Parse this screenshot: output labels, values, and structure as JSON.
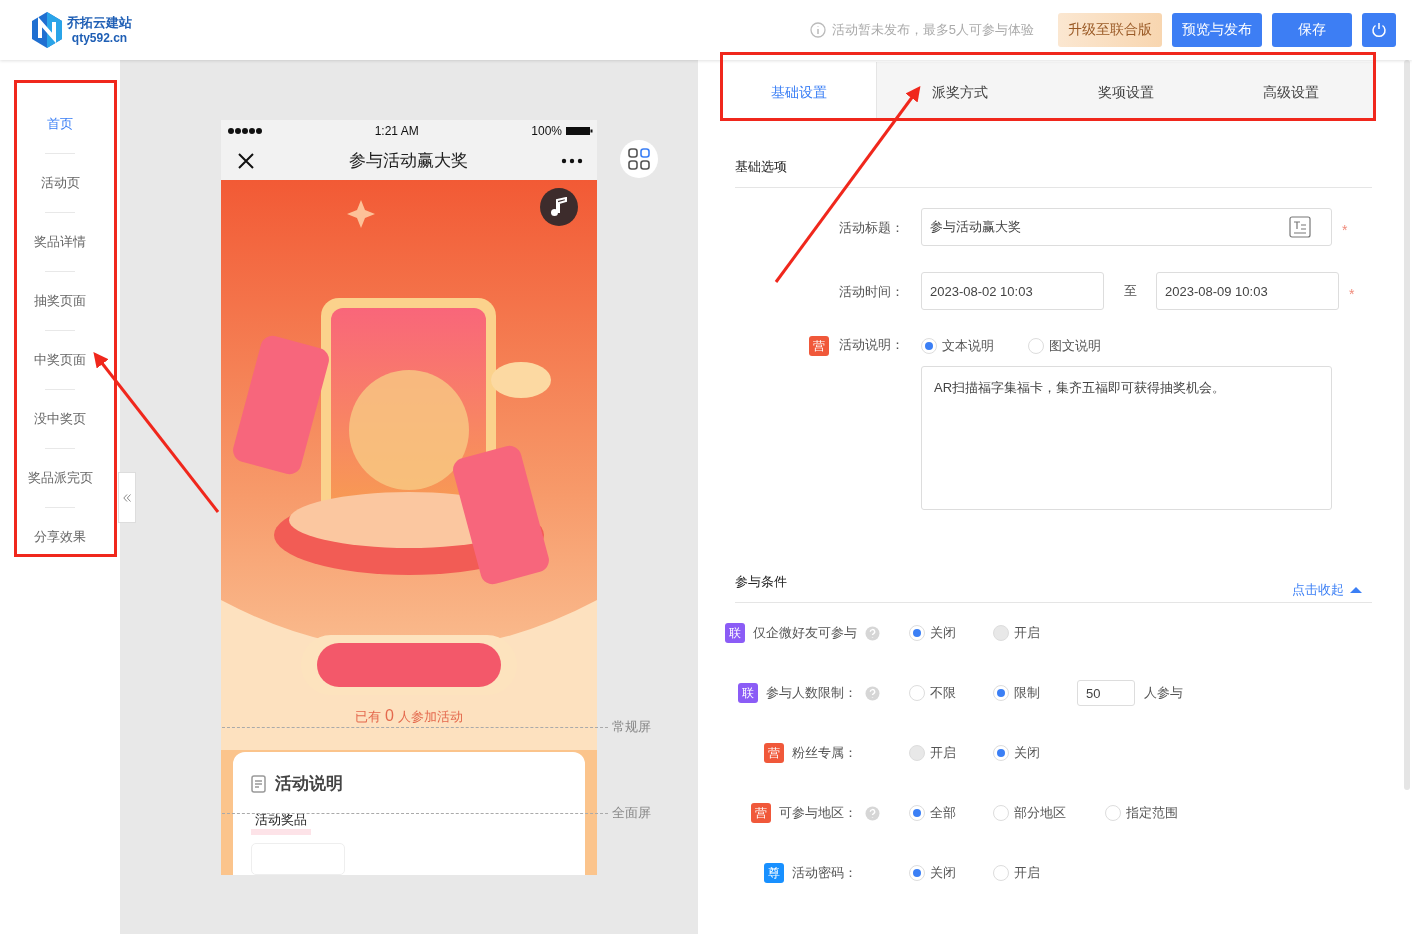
{
  "header": {
    "logo_name": "乔拓云建站",
    "logo_domain": "qty592.cn",
    "notice": "活动暂未发布，最多5人可参与体验",
    "buttons": [
      {
        "label": "升级至联合版",
        "kind": "upgrade"
      },
      {
        "label": "预览与发布",
        "kind": "primary"
      },
      {
        "label": "保存",
        "kind": "primary"
      }
    ]
  },
  "sidebar": {
    "items": [
      {
        "label": "首页",
        "selected": true
      },
      {
        "label": "活动页",
        "selected": false
      },
      {
        "label": "奖品详情",
        "selected": false
      },
      {
        "label": "抽奖页面",
        "selected": false
      },
      {
        "label": "中奖页面",
        "selected": false
      },
      {
        "label": "没中奖页",
        "selected": false
      },
      {
        "label": "奖品派完页",
        "selected": false
      },
      {
        "label": "分享效果",
        "selected": false
      }
    ]
  },
  "preview": {
    "status_bar": {
      "time": "1:21 AM",
      "battery": "100%"
    },
    "page_title": "参与活动赢大奖",
    "participants": {
      "prefix": "已有",
      "count": "0",
      "suffix": "人参加活动"
    },
    "card": {
      "title": "活动说明",
      "tab": "活动奖品"
    },
    "screen_marks": [
      "常规屏",
      "全面屏"
    ]
  },
  "tabs": [
    {
      "label": "基础设置",
      "selected": true
    },
    {
      "label": "派奖方式",
      "selected": false
    },
    {
      "label": "奖项设置",
      "selected": false
    },
    {
      "label": "高级设置",
      "selected": false
    }
  ],
  "basic": {
    "title": "基础选项",
    "fields": [
      {
        "kind": "text",
        "label": "活动标题：",
        "value": "参与活动赢大奖",
        "required_mark": "*"
      },
      {
        "kind": "daterange",
        "label": "活动时间：",
        "start": "2023-08-02 10:03",
        "separator": "至",
        "end": "2023-08-09 10:03",
        "required_mark": "*"
      },
      {
        "kind": "description",
        "label": "活动说明：",
        "badge": {
          "text": "营",
          "color": "#f0583a"
        },
        "options": [
          {
            "label": "文本说明",
            "selected": true,
            "disabled": false
          },
          {
            "label": "图文说明",
            "selected": false,
            "disabled": false
          }
        ],
        "content": "AR扫描福字集福卡，集齐五福即可获得抽奖机会。"
      }
    ]
  },
  "conditions": {
    "title": "参与条件",
    "collapse_link": "点击收起",
    "rows": [
      {
        "label": "仅企微好友可参与",
        "badge": {
          "text": "联",
          "color": "#8b5cf6"
        },
        "help": true,
        "options": [
          {
            "label": "关闭",
            "selected": true,
            "disabled": false
          },
          {
            "label": "开启",
            "selected": false,
            "disabled": true
          }
        ]
      },
      {
        "label": "参与人数限制：",
        "badge": {
          "text": "联",
          "color": "#8b5cf6"
        },
        "help": true,
        "options": [
          {
            "label": "不限",
            "selected": false,
            "disabled": false
          },
          {
            "label": "限制",
            "selected": true,
            "disabled": false
          }
        ],
        "limit": {
          "value": "50",
          "suffix": "人参与"
        }
      },
      {
        "label": "粉丝专属：",
        "badge": {
          "text": "营",
          "color": "#f0583a"
        },
        "help": false,
        "options": [
          {
            "label": "开启",
            "selected": false,
            "disabled": true
          },
          {
            "label": "关闭",
            "selected": true,
            "disabled": false
          }
        ]
      },
      {
        "label": "可参与地区：",
        "badge": {
          "text": "营",
          "color": "#f0583a"
        },
        "help": true,
        "options": [
          {
            "label": "全部",
            "selected": true,
            "disabled": false
          },
          {
            "label": "部分地区",
            "selected": false,
            "disabled": false
          },
          {
            "label": "指定范围",
            "selected": false,
            "disabled": false
          }
        ]
      },
      {
        "label": "活动密码：",
        "badge": {
          "text": "尊",
          "color": "#1890ff"
        },
        "help": false,
        "options": [
          {
            "label": "关闭",
            "selected": true,
            "disabled": false
          },
          {
            "label": "开启",
            "selected": false,
            "disabled": false
          }
        ]
      }
    ]
  }
}
